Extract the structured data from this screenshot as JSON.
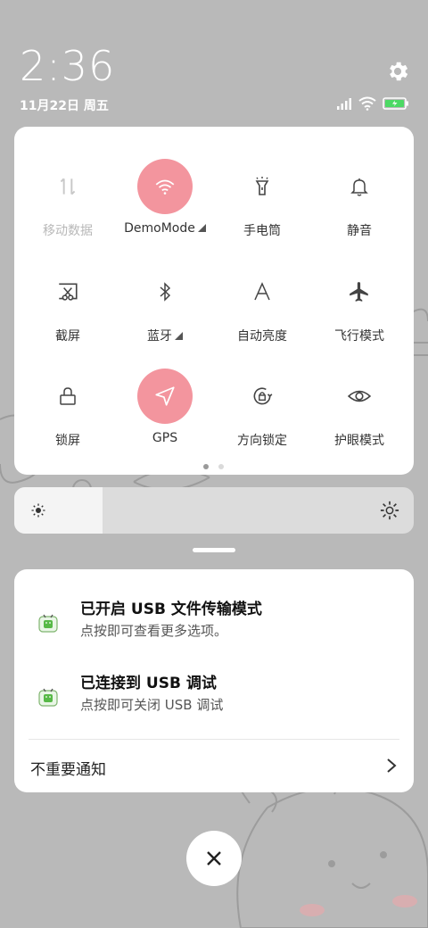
{
  "status_bar": {
    "time": "2:36",
    "date": "11月22日 周五",
    "battery_color": "#4cd964"
  },
  "quick_settings": {
    "accent_color": "#f3959e",
    "tiles": [
      {
        "label": "移动数据",
        "icon": "mobile-data-icon",
        "active": false,
        "disabled": true
      },
      {
        "label": "DemoMode",
        "icon": "wifi-icon",
        "active": true,
        "expandable": true
      },
      {
        "label": "手电筒",
        "icon": "flashlight-icon",
        "active": false
      },
      {
        "label": "静音",
        "icon": "bell-icon",
        "active": false
      },
      {
        "label": "截屏",
        "icon": "screenshot-icon",
        "active": false
      },
      {
        "label": "蓝牙",
        "icon": "bluetooth-icon",
        "active": false,
        "expandable": true
      },
      {
        "label": "自动亮度",
        "icon": "auto-brightness-icon",
        "active": false
      },
      {
        "label": "飞行模式",
        "icon": "airplane-icon",
        "active": false
      },
      {
        "label": "锁屏",
        "icon": "lock-icon",
        "active": false
      },
      {
        "label": "GPS",
        "icon": "location-icon",
        "active": true
      },
      {
        "label": "方向锁定",
        "icon": "rotation-lock-icon",
        "active": false
      },
      {
        "label": "护眼模式",
        "icon": "eye-icon",
        "active": false
      }
    ],
    "page_count": 2,
    "current_page": 1
  },
  "brightness": {
    "level_fraction": 0.22
  },
  "notifications": {
    "items": [
      {
        "title": "已开启 USB 文件传输模式",
        "subtitle": "点按即可查看更多选项。",
        "icon": "android-icon"
      },
      {
        "title": "已连接到 USB 调试",
        "subtitle": "点按即可关闭 USB 调试",
        "icon": "android-icon"
      }
    ],
    "unimportant_label": "不重要通知"
  }
}
